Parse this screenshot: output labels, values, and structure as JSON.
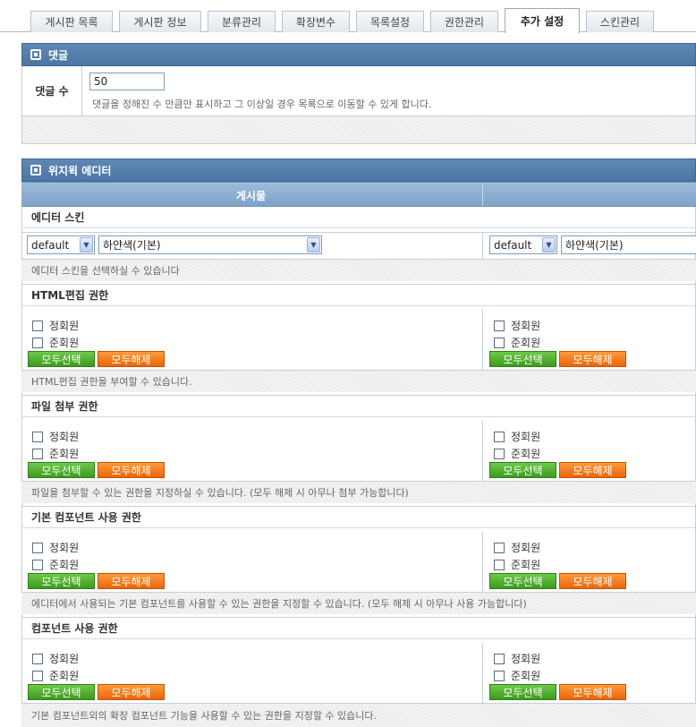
{
  "tabs": [
    {
      "label": "게시판 목록",
      "active": false
    },
    {
      "label": "게시판 정보",
      "active": false
    },
    {
      "label": "분류관리",
      "active": false
    },
    {
      "label": "확장변수",
      "active": false
    },
    {
      "label": "목록설정",
      "active": false
    },
    {
      "label": "권한관리",
      "active": false
    },
    {
      "label": "추가 설정",
      "active": true
    },
    {
      "label": "스킨관리",
      "active": false
    }
  ],
  "comments": {
    "title": "댓글",
    "count_label": "댓글 수",
    "count_value": "50",
    "count_desc": "댓글을 정해진 수 만큼만 표시하고 그 이상일 경우 목록으로 이동할 수 있게 합니다."
  },
  "editor": {
    "title": "위지윅 에디터",
    "col_post": "게시물",
    "skin": {
      "label": "에디터 스킨",
      "left_skin": "default",
      "left_color": "하얀색(기본)",
      "right_skin": "default",
      "right_color": "하얀색(기본)",
      "desc": "에디터 스킨을 선택하실 수 있습니다"
    },
    "html_perm": {
      "label": "HTML편집 권한",
      "desc": "HTML편집 권한을 부여할 수 있습니다."
    },
    "file_perm": {
      "label": "파일 첨부 권한",
      "desc": "파일을 첨부할 수 있는 권한을 지정하실 수 있습니다. (모두 해제 시 아무나 첨부 가능합니다)"
    },
    "basic_comp_perm": {
      "label": "기본 컴포넌트 사용 권한",
      "desc": "에디터에서 사용되는 기본 컴포넌트를 사용할 수 있는 권한을 지정할 수 있습니다. (모두 해제 시 아무나 사용 가능합니다)"
    },
    "comp_perm": {
      "label": "컴포넌트 사용 권한",
      "desc": "기본 컴포넌트외의 확장 컴포넌트 기능을 사용할 수 있는 권한을 지정할 수 있습니다."
    },
    "groups": [
      "정회원",
      "준회원"
    ],
    "select_all": "모두선택",
    "deselect_all": "모두해제"
  },
  "colors": {
    "header_bar": "#4b76a5",
    "col_header": "#8aaed2",
    "btn_green": "#3e9a1e",
    "btn_orange": "#e8660a"
  }
}
